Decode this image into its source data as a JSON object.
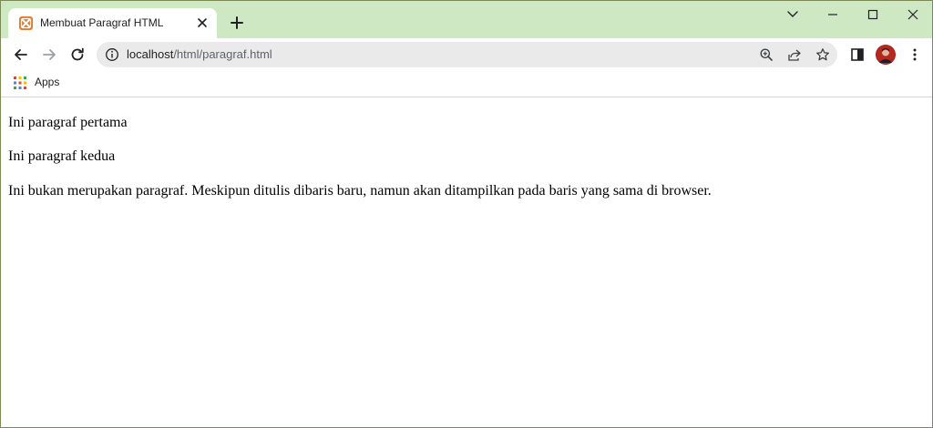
{
  "tab": {
    "title": "Membuat Paragraf HTML"
  },
  "address_bar": {
    "host": "localhost",
    "path": "/html/paragraf.html"
  },
  "bookmarks": {
    "apps_label": "Apps"
  },
  "content": {
    "paragraphs": [
      "Ini paragraf pertama",
      "Ini paragraf kedua",
      "Ini bukan merupakan paragraf. Meskipun ditulis dibaris baru, namun akan ditampilkan pada baris yang sama di browser."
    ]
  },
  "colors": {
    "tabstrip_bg": "#cfe8c4",
    "omnibox_bg": "#eaeaea",
    "favicon": "#e27b2c"
  }
}
